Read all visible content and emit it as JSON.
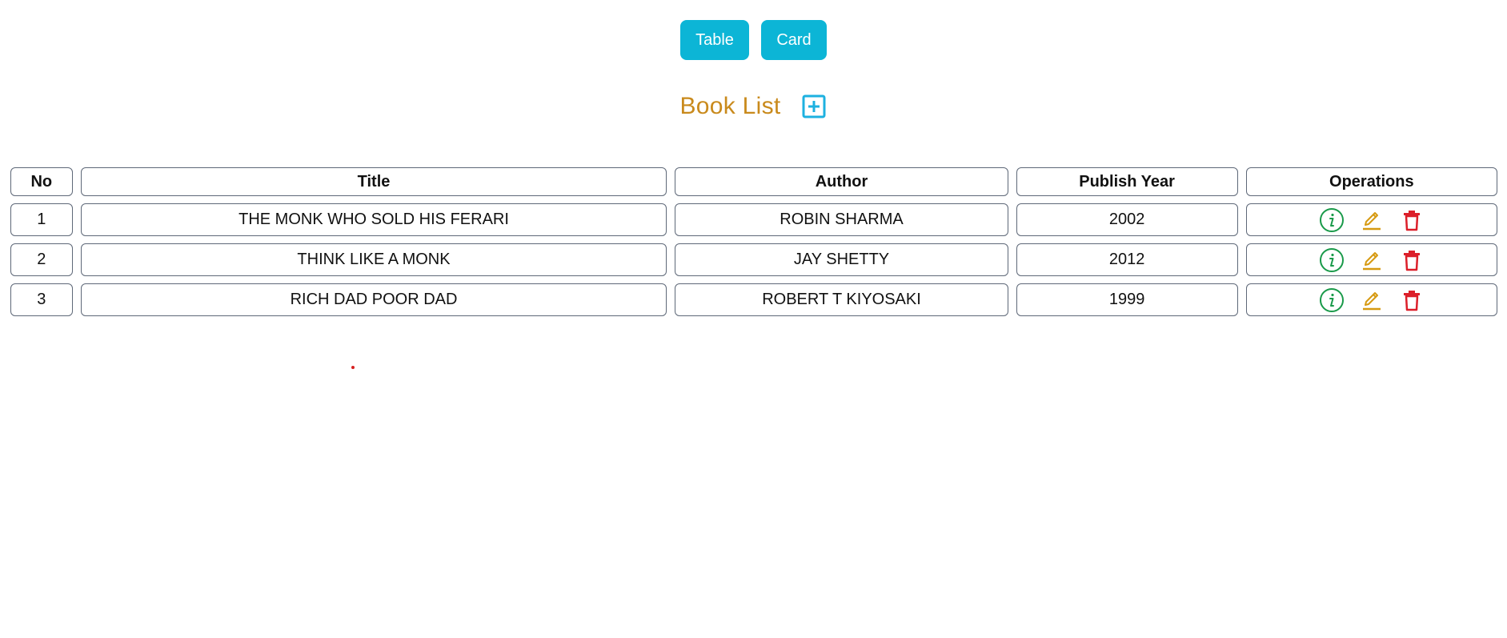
{
  "view_toggle": {
    "table_label": "Table",
    "card_label": "Card"
  },
  "header": {
    "title": "Book List",
    "add_icon": "plus-square-icon"
  },
  "table": {
    "columns": [
      "No",
      "Title",
      "Author",
      "Publish Year",
      "Operations"
    ],
    "rows": [
      {
        "no": "1",
        "title": "THE MONK WHO SOLD HIS FERARI",
        "author": "ROBIN SHARMA",
        "year": "2002"
      },
      {
        "no": "2",
        "title": "THINK LIKE A MONK",
        "author": "JAY SHETTY",
        "year": "2012"
      },
      {
        "no": "3",
        "title": "RICH DAD POOR DAD",
        "author": "ROBERT T KIYOSAKI",
        "year": "1999"
      }
    ],
    "operation_icons": [
      "info-circle-icon",
      "edit-pencil-icon",
      "trash-icon"
    ]
  },
  "colors": {
    "button_bg": "#0cb5d6",
    "title": "#c98a1c",
    "add_icon": "#1db1e0",
    "info": "#1a9a4a",
    "edit": "#d69a12",
    "delete": "#dc1f2a",
    "border": "#5e6878"
  }
}
